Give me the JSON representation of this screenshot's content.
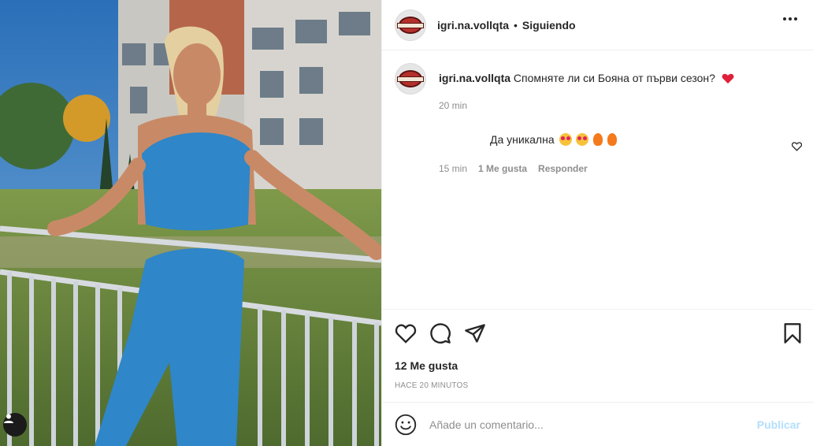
{
  "post": {
    "username": "igri.na.vollqta",
    "separator": "•",
    "follow_status": "Siguiendo"
  },
  "caption": {
    "username": "igri.na.vollqta",
    "text": "Спомняте ли си Бояна от първи сезон?",
    "time": "20 min",
    "emoji": "red-heart"
  },
  "reply": {
    "text": "Да уникална",
    "emojis": [
      "star-struck",
      "star-struck",
      "fire",
      "fire"
    ],
    "time": "15 min",
    "likes": "1 Me gusta",
    "reply_label": "Responder"
  },
  "stats": {
    "likes": "12 Me gusta",
    "time_ago": "HACE 20 MINUTOS"
  },
  "comment_box": {
    "placeholder": "Añade un comentario...",
    "publish_label": "Publicar"
  },
  "icons": {
    "more": "more-options-icon",
    "like": "heart-icon",
    "comment": "comment-icon",
    "share": "paper-plane-icon",
    "save": "bookmark-icon",
    "emoji": "smiley-icon",
    "tagged_user": "user-tag-icon"
  },
  "colors": {
    "text": "#262626",
    "muted": "#8e8e8e",
    "border": "#efefef",
    "publish_disabled": "#b2dffc",
    "heart_red": "#ed4956"
  }
}
